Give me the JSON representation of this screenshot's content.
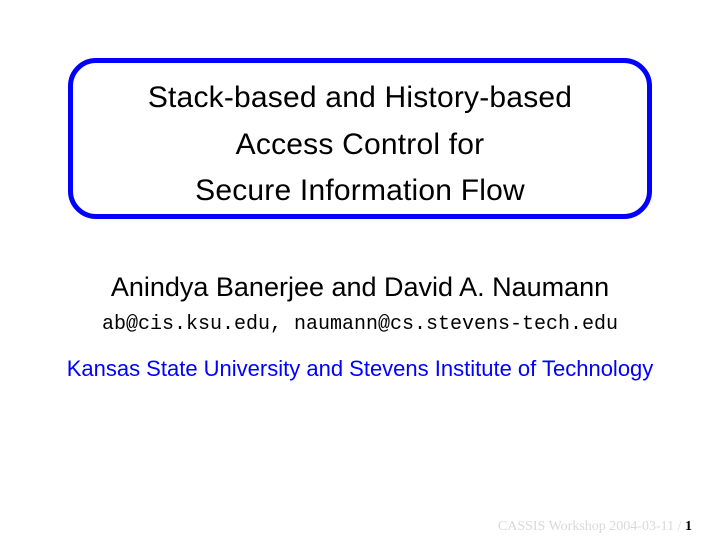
{
  "title": {
    "line1": "Stack-based and History-based",
    "line2": "Access Control for",
    "line3": "Secure Information Flow"
  },
  "authors": "Anindya Banerjee and David A. Naumann",
  "emails": "ab@cis.ksu.edu, naumann@cs.stevens-tech.edu",
  "affiliation": "Kansas State University and Stevens Institute of Technology",
  "footer": {
    "venue": "CASSIS Workshop 2004-03-11 / ",
    "page": "1"
  }
}
